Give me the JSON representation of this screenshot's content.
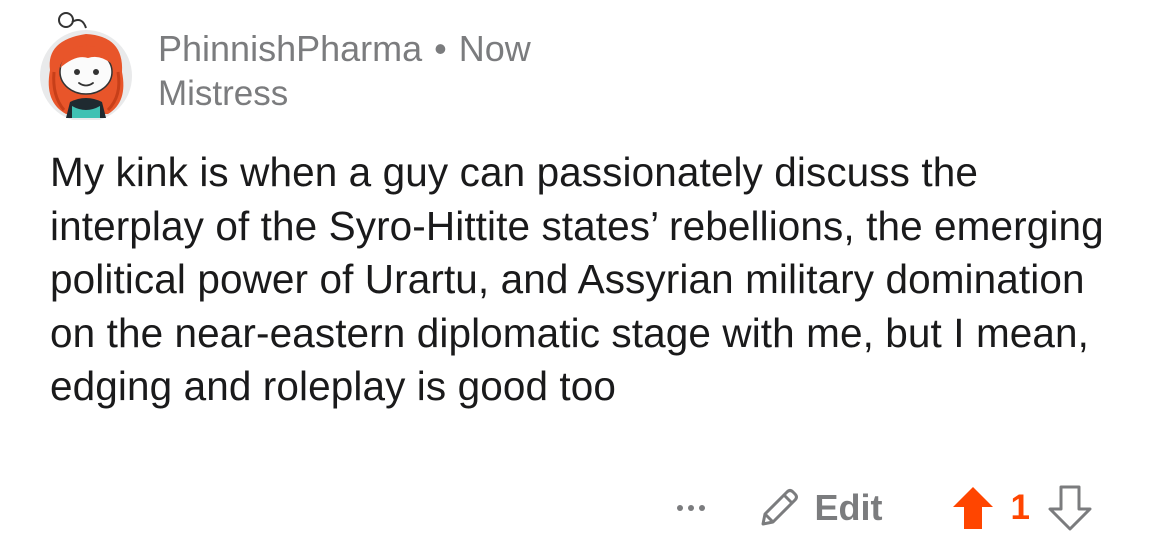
{
  "comment": {
    "author": {
      "username": "PhinnishPharma",
      "separator": "•",
      "timestamp": "Now",
      "flair": "Mistress"
    },
    "body": "My kink is when a guy can passionately discuss the interplay of the Syro-Hittite states’ rebellions, the emerging political power of Urartu, and Assyrian military domination on the near-eastern diplomatic stage with me, but I mean, edging and roleplay is good too",
    "actions": {
      "edit_label": "Edit",
      "score": "1"
    }
  },
  "colors": {
    "upvote_accent": "#ff4500",
    "meta_gray": "#7b7c7e",
    "text": "#1a1a1b",
    "avatar_hair": "#e8552a"
  },
  "icons": {
    "avatar": "snoo-avatar-icon",
    "more": "more-options-icon",
    "edit": "pencil-icon",
    "upvote": "upvote-arrow-icon",
    "downvote": "downvote-arrow-icon"
  }
}
